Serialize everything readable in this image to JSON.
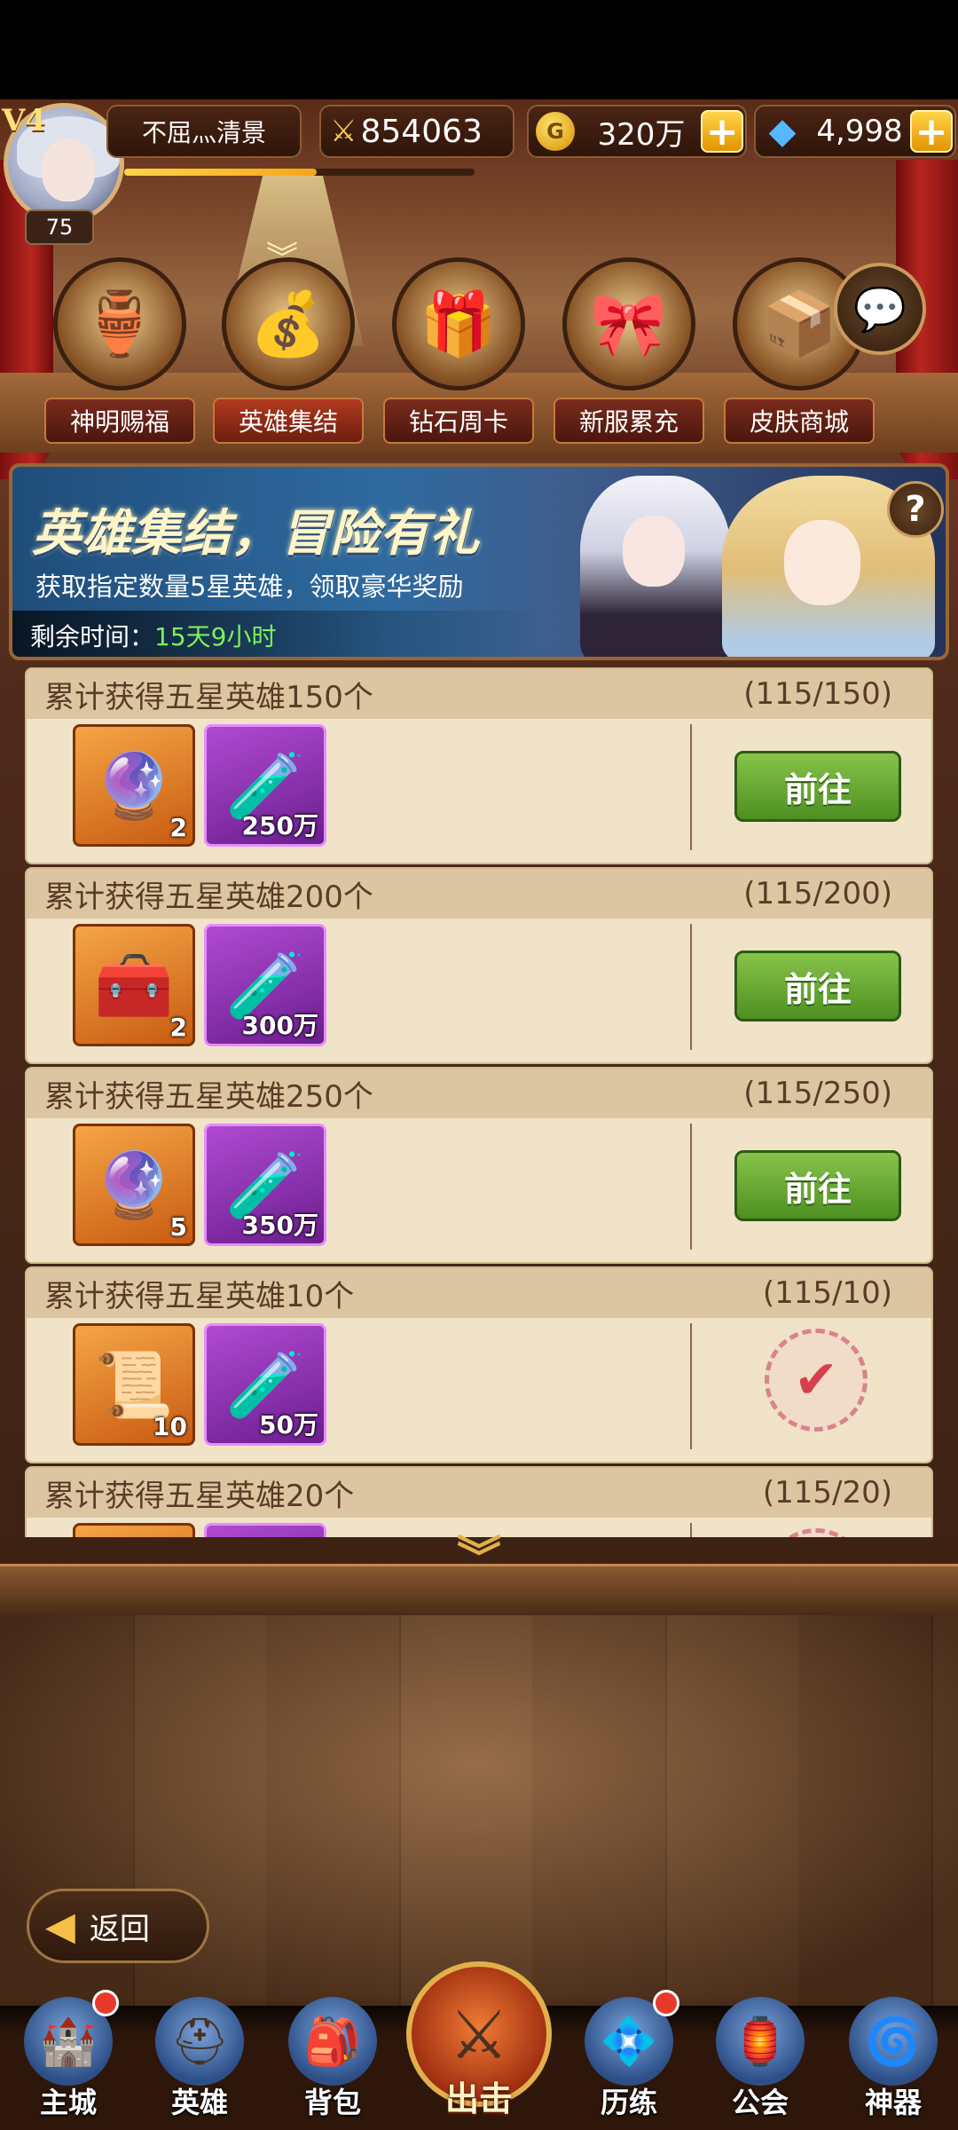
{
  "player": {
    "vip": "V4",
    "name": "不屈灬清景",
    "level": "75",
    "power": "854063",
    "gold": "320万",
    "diamonds": "4,998",
    "exp_fraction": 0.55
  },
  "tabs": [
    {
      "label": "神明赐福",
      "icon": "divine-chest-icon",
      "glyph": "🏺"
    },
    {
      "label": "英雄集结",
      "icon": "hero-treasure-icon",
      "glyph": "💰"
    },
    {
      "label": "钻石周卡",
      "icon": "diamond-gift-icon",
      "glyph": "🎁"
    },
    {
      "label": "新服累充",
      "icon": "gift-box-icon",
      "glyph": "🎀"
    },
    {
      "label": "皮肤商城",
      "icon": "skin-box-icon",
      "glyph": "📦"
    }
  ],
  "banner": {
    "title": "英雄集结，冒险有礼",
    "description": "获取指定数量5星英雄，领取豪华奖励",
    "time_label": "剩余时间：",
    "time_value": "15天9小时",
    "help": "?"
  },
  "tasks": [
    {
      "title": "累计获得五星英雄150个",
      "progress": "(115/150)",
      "status": "go",
      "button": "前往",
      "rewards": [
        {
          "icon": "purple-orb-icon",
          "glyph": "🔮",
          "rarity": "orange",
          "count": "2"
        },
        {
          "icon": "green-potion-icon",
          "glyph": "🧪",
          "rarity": "purple",
          "count": "250万"
        }
      ]
    },
    {
      "title": "累计获得五星英雄200个",
      "progress": "(115/200)",
      "status": "go",
      "button": "前往",
      "rewards": [
        {
          "icon": "dark-chest-icon",
          "glyph": "🧰",
          "rarity": "orange",
          "count": "2"
        },
        {
          "icon": "green-potion-icon",
          "glyph": "🧪",
          "rarity": "purple",
          "count": "300万"
        }
      ]
    },
    {
      "title": "累计获得五星英雄250个",
      "progress": "(115/250)",
      "status": "go",
      "button": "前往",
      "rewards": [
        {
          "icon": "purple-orb-icon",
          "glyph": "🔮",
          "rarity": "orange",
          "count": "5"
        },
        {
          "icon": "green-potion-icon",
          "glyph": "🧪",
          "rarity": "purple",
          "count": "350万"
        }
      ]
    },
    {
      "title": "累计获得五星英雄10个",
      "progress": "(115/10)",
      "status": "done",
      "button": "",
      "rewards": [
        {
          "icon": "scroll-icon",
          "glyph": "📜",
          "rarity": "orange",
          "count": "10"
        },
        {
          "icon": "green-potion-icon",
          "glyph": "🧪",
          "rarity": "purple",
          "count": "50万"
        }
      ]
    },
    {
      "title": "累计获得五星英雄20个",
      "progress": "(115/20)",
      "status": "done",
      "button": "",
      "rewards": [
        {
          "icon": "scroll-icon",
          "glyph": "📜",
          "rarity": "orange",
          "count": ""
        },
        {
          "icon": "green-potion-icon",
          "glyph": "🧪",
          "rarity": "purple",
          "count": ""
        }
      ]
    }
  ],
  "back_label": "返回",
  "nav": [
    {
      "label": "主城",
      "icon": "castle-icon",
      "glyph": "🏰",
      "dot": true
    },
    {
      "label": "英雄",
      "icon": "helmet-icon",
      "glyph": "⛑",
      "dot": false
    },
    {
      "label": "背包",
      "icon": "backpack-icon",
      "glyph": "🎒",
      "dot": false
    },
    {
      "label": "出击",
      "icon": "crossed-swords-icon",
      "glyph": "⚔",
      "dot": false
    },
    {
      "label": "历练",
      "icon": "training-icon",
      "glyph": "💠",
      "dot": true
    },
    {
      "label": "公会",
      "icon": "guild-icon",
      "glyph": "🏮",
      "dot": false
    },
    {
      "label": "神器",
      "icon": "artifact-icon",
      "glyph": "🌀",
      "dot": false
    }
  ],
  "colors": {
    "go_button": "#4e8f21",
    "time_value": "#7cf05a",
    "plus": "#e39400"
  }
}
